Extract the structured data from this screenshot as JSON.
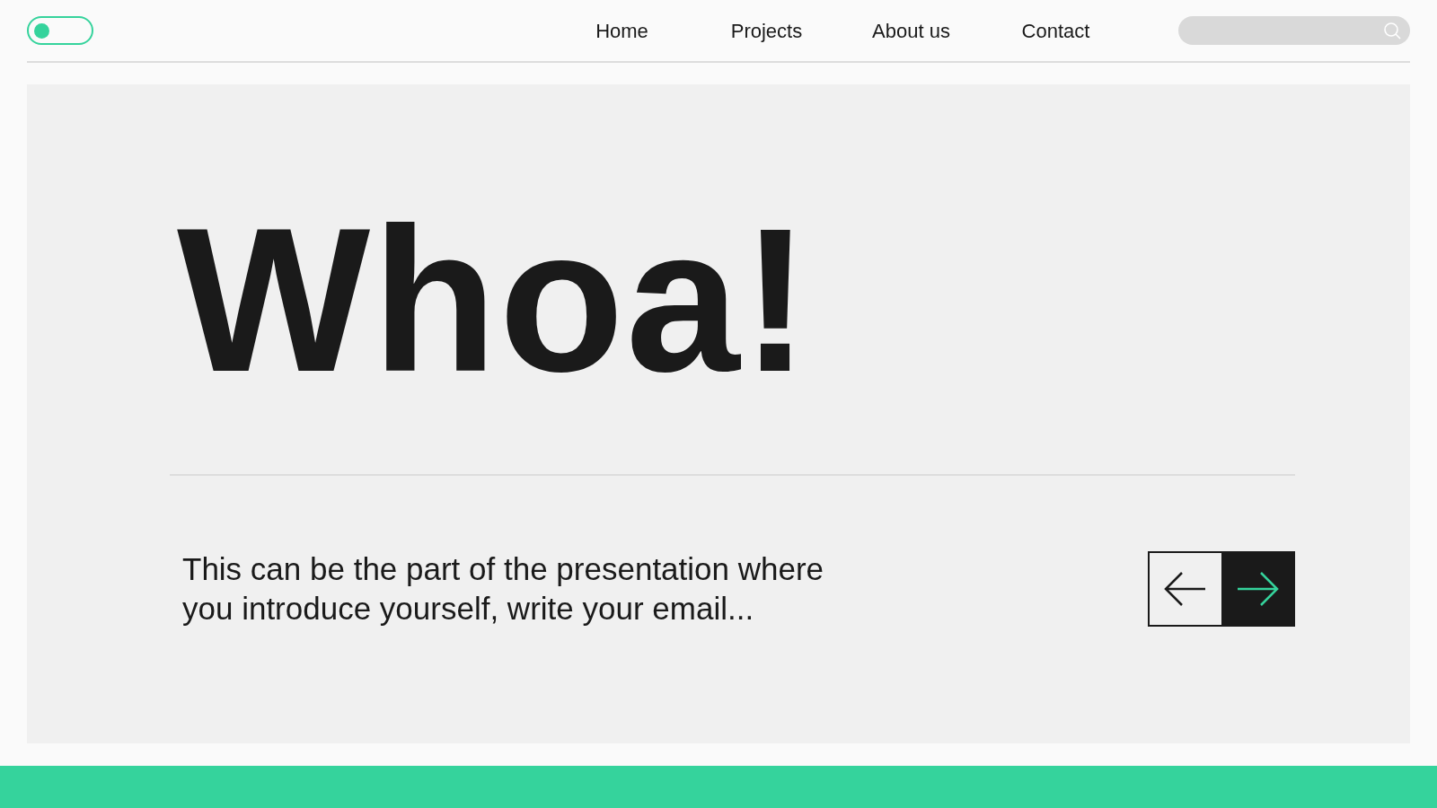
{
  "header": {
    "toggle": {
      "on": false
    },
    "nav": [
      {
        "label": "Home"
      },
      {
        "label": "Projects"
      },
      {
        "label": "About us"
      },
      {
        "label": "Contact"
      }
    ]
  },
  "hero": {
    "title": "Whoa!",
    "text": "This can be the part of the presentation where you introduce yourself, write your email...",
    "arrows": [
      {
        "kind": "prev",
        "selected": false
      },
      {
        "kind": "next",
        "selected": true
      }
    ]
  }
}
